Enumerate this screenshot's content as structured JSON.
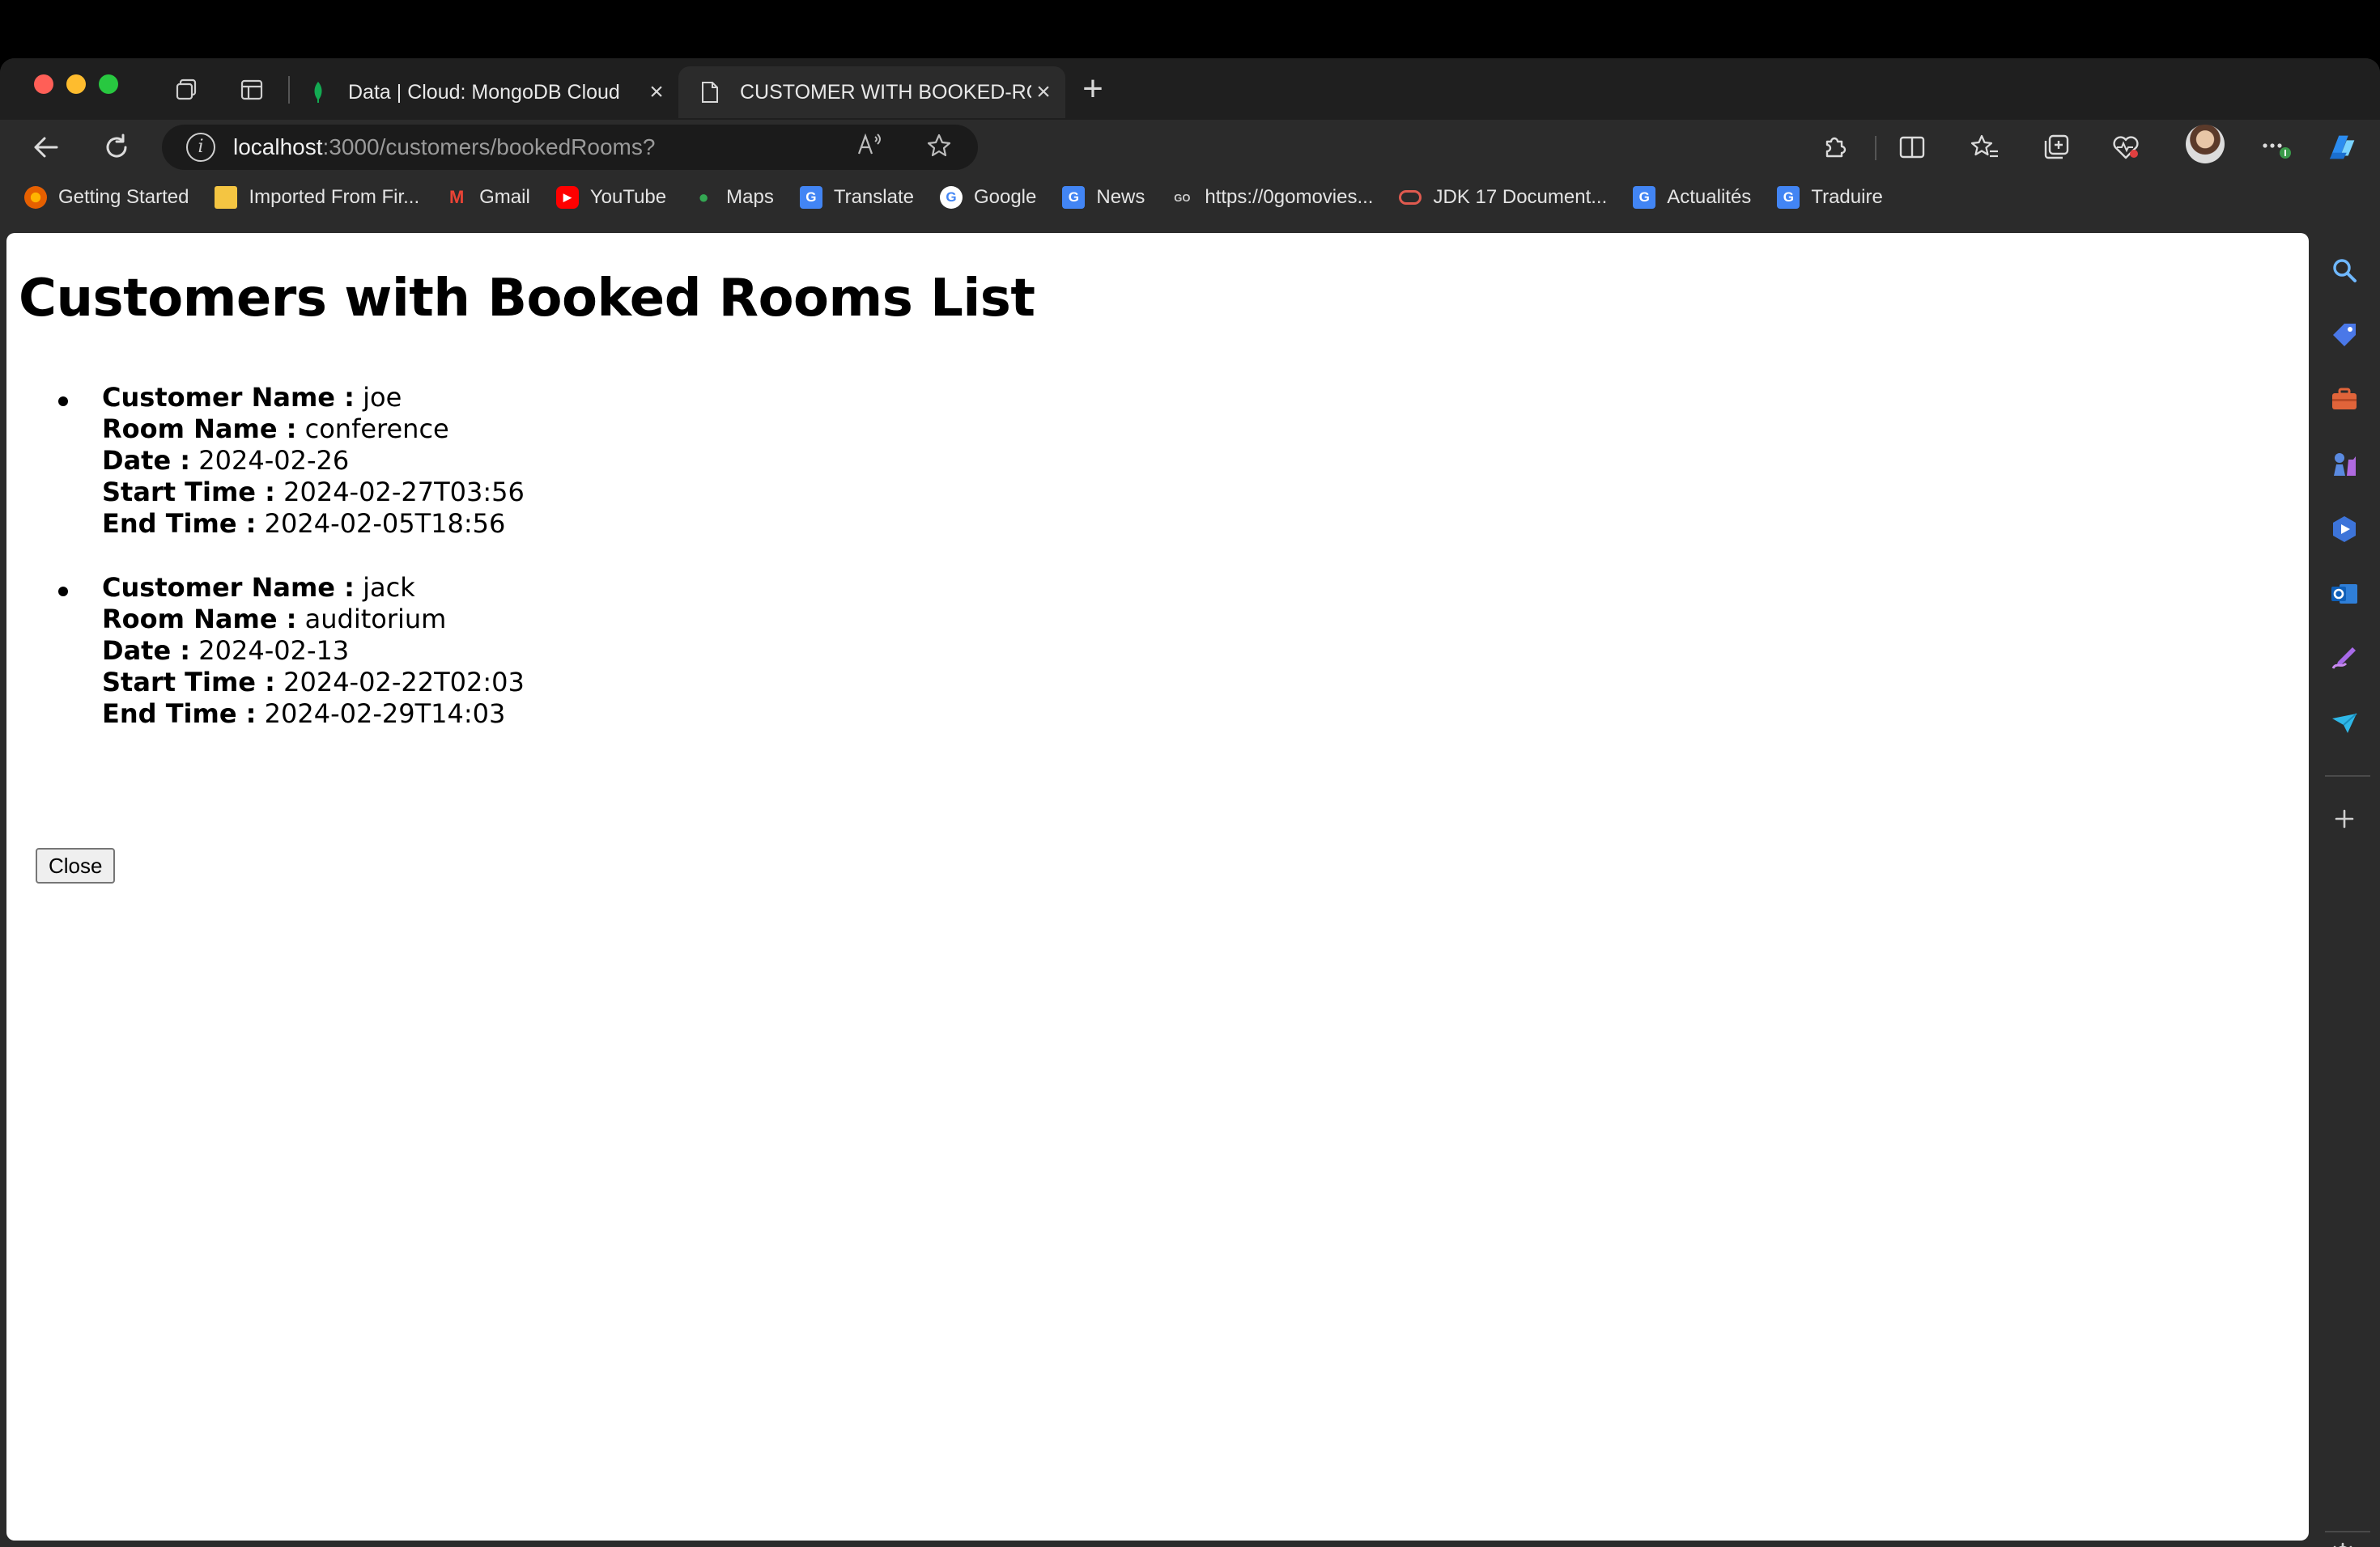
{
  "browser": {
    "tabs": [
      {
        "title": "Data | Cloud: MongoDB Cloud",
        "active": false,
        "icon": "mongodb-leaf-icon"
      },
      {
        "title": "CUSTOMER WITH BOOKED-RO",
        "active": true,
        "icon": "page-icon"
      }
    ],
    "address": {
      "host": "localhost",
      "rest": ":3000/customers/bookedRooms?"
    },
    "bookmarks": [
      {
        "label": "Getting Started",
        "icon": "firefox-icon",
        "color": "#e66000"
      },
      {
        "label": "Imported From Fir...",
        "icon": "folder-icon",
        "color": "#f4c542"
      },
      {
        "label": "Gmail",
        "icon": "gmail-icon",
        "color": "#ea4335"
      },
      {
        "label": "YouTube",
        "icon": "youtube-icon",
        "color": "#ff0000"
      },
      {
        "label": "Maps",
        "icon": "maps-pin-icon",
        "color": "#34a853"
      },
      {
        "label": "Translate",
        "icon": "translate-icon",
        "color": "#4285f4"
      },
      {
        "label": "Google",
        "icon": "google-icon",
        "color": "#ffffff"
      },
      {
        "label": "News",
        "icon": "news-icon",
        "color": "#4285f4"
      },
      {
        "label": "https://0gomovies...",
        "icon": "gomovies-icon",
        "color": "#2b2b2b"
      },
      {
        "label": "JDK 17 Document...",
        "icon": "oracle-icon",
        "color": "#e05a4f"
      },
      {
        "label": "Actualités",
        "icon": "news-icon",
        "color": "#4285f4"
      },
      {
        "label": "Traduire",
        "icon": "translate-icon",
        "color": "#4285f4"
      }
    ]
  },
  "page": {
    "heading": "Customers with Booked Rooms List",
    "labels": {
      "customer": "Customer Name :",
      "room": "Room Name :",
      "date": "Date :",
      "start": "Start Time :",
      "end": "End Time :"
    },
    "bookings": [
      {
        "customer": "joe",
        "room": "conference",
        "date": "2024-02-26",
        "start": "2024-02-27T03:56",
        "end": "2024-02-05T18:56"
      },
      {
        "customer": "jack",
        "room": "auditorium",
        "date": "2024-02-13",
        "start": "2024-02-22T02:03",
        "end": "2024-02-29T14:03"
      }
    ],
    "close_label": "Close"
  }
}
